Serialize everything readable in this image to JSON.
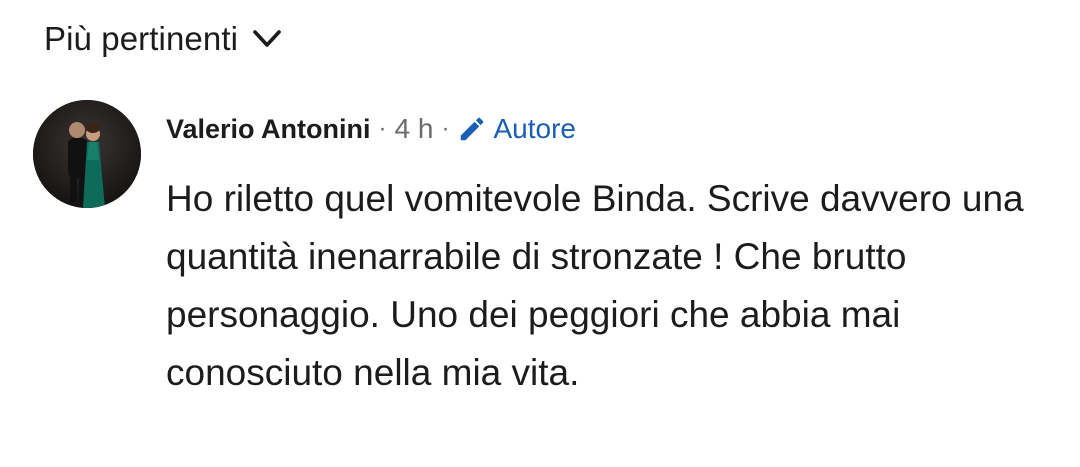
{
  "sort": {
    "label": "Più pertinenti",
    "icon": "chevron-down-icon"
  },
  "comment": {
    "author": "Valerio Antonini",
    "separator": "·",
    "time": "4 h",
    "badge": {
      "label": "Autore",
      "icon": "pencil-icon",
      "color": "#1a5fb4"
    },
    "text": "Ho riletto quel vomitevole Binda. Scrive davvero una quantità inenarrabile di stronzate ! Che brutto personaggio. Uno dei peggiori che abbia mai conosciuto nella mia vita."
  }
}
